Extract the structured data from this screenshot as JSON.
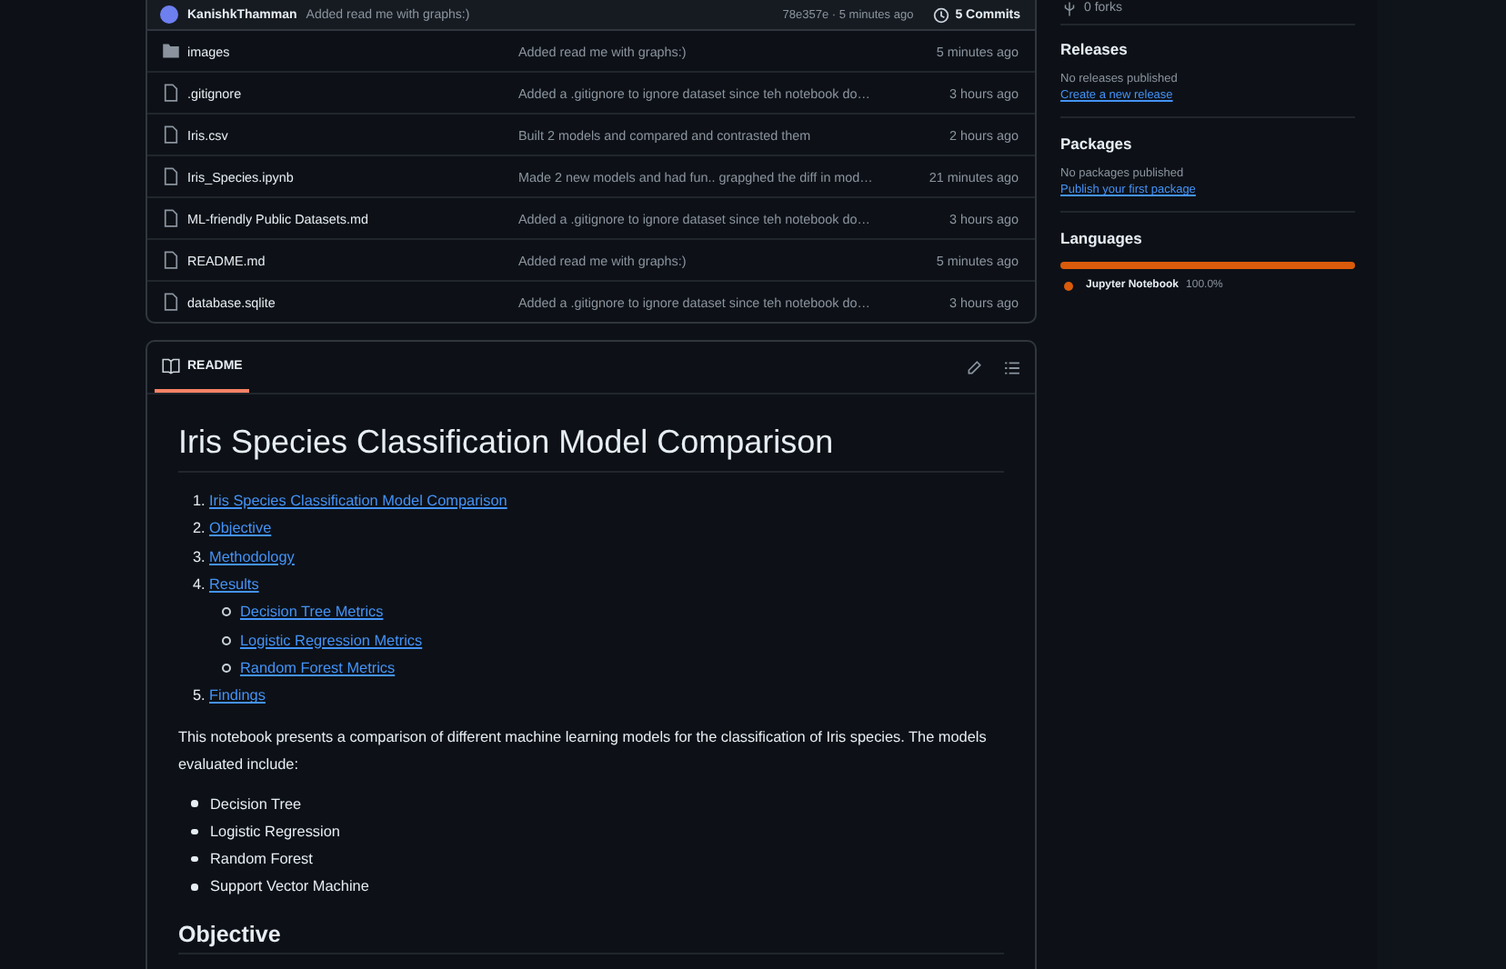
{
  "commit_bar": {
    "author": "KanishkThamman",
    "message": "Added read me with graphs:)",
    "hash_time": "78e357e · 5 minutes ago",
    "commits": "5 Commits"
  },
  "files": [
    {
      "kind": "folder",
      "name": "images",
      "message": "Added read me with graphs:)",
      "time": "5 minutes ago"
    },
    {
      "kind": "file",
      "name": ".gitignore",
      "message": "Added a .gitignore to ignore dataset since teh notebook do…",
      "time": "3 hours ago"
    },
    {
      "kind": "file",
      "name": "Iris.csv",
      "message": "Built 2 models and compared and contrasted them",
      "time": "2 hours ago"
    },
    {
      "kind": "file",
      "name": "Iris_Species.ipynb",
      "message": "Made 2 new models and had fun.. grapghed the diff in mod…",
      "time": "21 minutes ago"
    },
    {
      "kind": "file",
      "name": "ML-friendly Public Datasets.md",
      "message": "Added a .gitignore to ignore dataset since teh notebook do…",
      "time": "3 hours ago"
    },
    {
      "kind": "file",
      "name": "README.md",
      "message": "Added read me with graphs:)",
      "time": "5 minutes ago"
    },
    {
      "kind": "file",
      "name": "database.sqlite",
      "message": "Added a .gitignore to ignore dataset since teh notebook do…",
      "time": "3 hours ago"
    }
  ],
  "readme": {
    "tab": {
      "label": "README",
      "selected": true
    },
    "title": "Iris Species Classification Model Comparison",
    "toc": [
      {
        "number": "1.",
        "label": "Iris Species Classification Model Comparison"
      },
      {
        "number": "2.",
        "label": "Objective"
      },
      {
        "number": "3.",
        "label": "Methodology"
      },
      {
        "number": "4.",
        "label": "Results",
        "children": [
          {
            "label": "Decision Tree Metrics"
          },
          {
            "label": "Logistic Regression Metrics"
          },
          {
            "label": "Random Forest Metrics"
          }
        ]
      },
      {
        "number": "5.",
        "label": "Findings"
      }
    ],
    "intro": "This notebook presents a comparison of different machine learning models for the classification of Iris species. The models evaluated include:",
    "models": [
      "Decision Tree",
      "Logistic Regression",
      "Random Forest",
      "Support Vector Machine"
    ],
    "section_heading": "Objective"
  },
  "sidebar": {
    "forks": "0 forks",
    "sections": [
      {
        "kind": "links",
        "title": "Releases",
        "text": "No releases published",
        "link": "Create a new release"
      },
      {
        "kind": "links",
        "title": "Packages",
        "text": "No packages published",
        "link": "Publish your first package"
      },
      {
        "kind": "languages",
        "title": "Languages",
        "languages": [
          {
            "name": "Jupyter Notebook",
            "percent": "100.0%",
            "color": "#da5b0b",
            "level": 1.0
          }
        ]
      }
    ]
  }
}
